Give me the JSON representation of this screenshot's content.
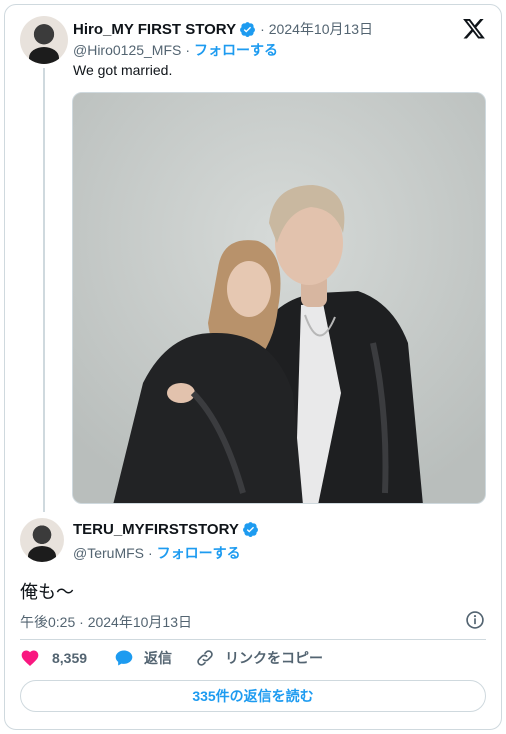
{
  "quoted_tweet": {
    "author_name": "Hiro_MY FIRST STORY",
    "date": "2024年10月13日",
    "handle": "@Hiro0125_MFS",
    "follow_label": "フォローする",
    "separator": "·",
    "text": "We got married."
  },
  "reply_tweet": {
    "author_name": "TERU_MYFIRSTSTORY",
    "handle": "@TeruMFS",
    "follow_label": "フォローする",
    "separator": "·",
    "text": "俺も〜",
    "timestamp": "午後0:25 · 2024年10月13日"
  },
  "actions": {
    "like_count": "8,359",
    "reply_label": "返信",
    "copy_link_label": "リンクをコピー"
  },
  "read_replies_label": "335件の返信を読む",
  "icons": {
    "brand": "x-logo-icon",
    "verified": "verified-badge-icon",
    "like": "heart-icon",
    "reply": "speech-bubble-icon",
    "link": "link-icon",
    "info": "info-icon"
  },
  "colors": {
    "accent": "#1d9bf0",
    "like": "#f91880",
    "muted": "#536471",
    "border": "#cfd9de"
  }
}
